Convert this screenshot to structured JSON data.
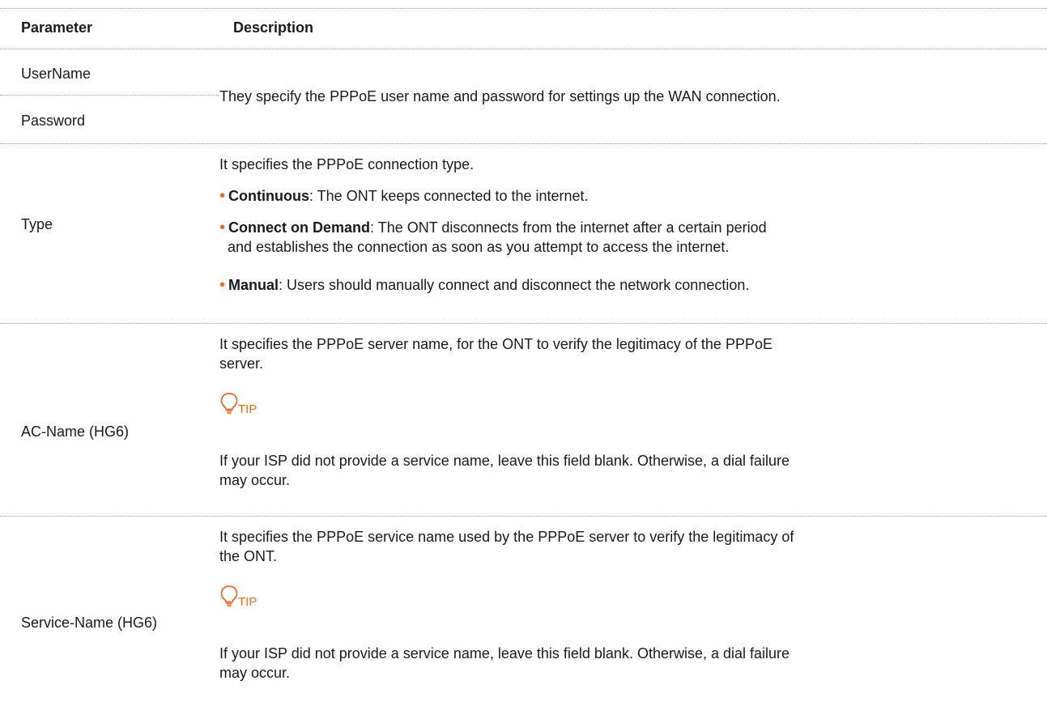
{
  "header": {
    "param": "Parameter",
    "desc": "Description"
  },
  "rows": {
    "username": {
      "param": "UserName"
    },
    "password": {
      "param": "Password"
    },
    "userpass_desc": "They specify the PPPoE user name and password for settings up the WAN connection.",
    "type": {
      "param": "Type",
      "intro": "It specifies the PPPoE connection type.",
      "items": [
        {
          "term": "Continuous",
          "text": ": The ONT keeps connected to the internet."
        },
        {
          "term": "Connect on Demand",
          "text": ": The ONT disconnects from the internet after a certain period",
          "text2": "and establishes the connection as soon as you attempt to access the internet."
        },
        {
          "term": "Manual",
          "text": ": Users should manually connect and disconnect the network connection."
        }
      ]
    },
    "acname": {
      "param": "AC-Name (HG6)",
      "line1": "It specifies the PPPoE server name, for the ONT to verify the legitimacy of the PPPoE",
      "line2": "server.",
      "tip_label": "TIP",
      "tip1": "If your ISP did not provide a service name, leave this field blank. Otherwise, a dial failure",
      "tip2": "may occur."
    },
    "servicename": {
      "param": "Service-Name (HG6)",
      "line1": "It specifies the PPPoE service name used by the PPPoE server to verify the legitimacy of",
      "line2": "the ONT.",
      "tip_label": "TIP",
      "tip1": "If your ISP did not provide a service name, leave this field blank. Otherwise, a dial failure",
      "tip2": "may occur."
    }
  },
  "colors": {
    "accent": "#f06a1e",
    "rule": "#9a9a9a"
  },
  "icons": {
    "tip": "lightbulb-icon"
  }
}
